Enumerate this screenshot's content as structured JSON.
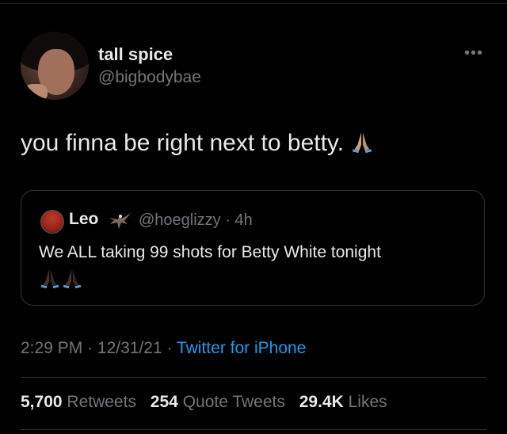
{
  "author": {
    "display_name": "tall spice",
    "handle": "@bigbodybae"
  },
  "menu": {
    "more_label": "•••"
  },
  "tweet": {
    "text": "you finna be right next to betty.",
    "emoji_icon": "folded-hands-icon"
  },
  "quoted_tweet": {
    "display_name": "Leo",
    "badge_icon": "eagle-icon",
    "handle": "@hoeglizzy",
    "separator": "·",
    "time": "4h",
    "text": "We ALL taking 99 shots for Betty White tonight",
    "emoji_icons": [
      "folded-hands-icon",
      "folded-hands-icon"
    ]
  },
  "meta": {
    "time": "2:29 PM",
    "separator": "·",
    "date": "12/31/21",
    "source": "Twitter for iPhone"
  },
  "stats": {
    "retweets_count": "5,700",
    "retweets_label": "Retweets",
    "quotes_count": "254",
    "quotes_label": "Quote Tweets",
    "likes_count": "29.4K",
    "likes_label": "Likes"
  },
  "colors": {
    "background": "#000000",
    "text_primary": "#e7e9ea",
    "text_secondary": "#71767b",
    "link": "#1d9bf0",
    "border": "#2f3336"
  }
}
